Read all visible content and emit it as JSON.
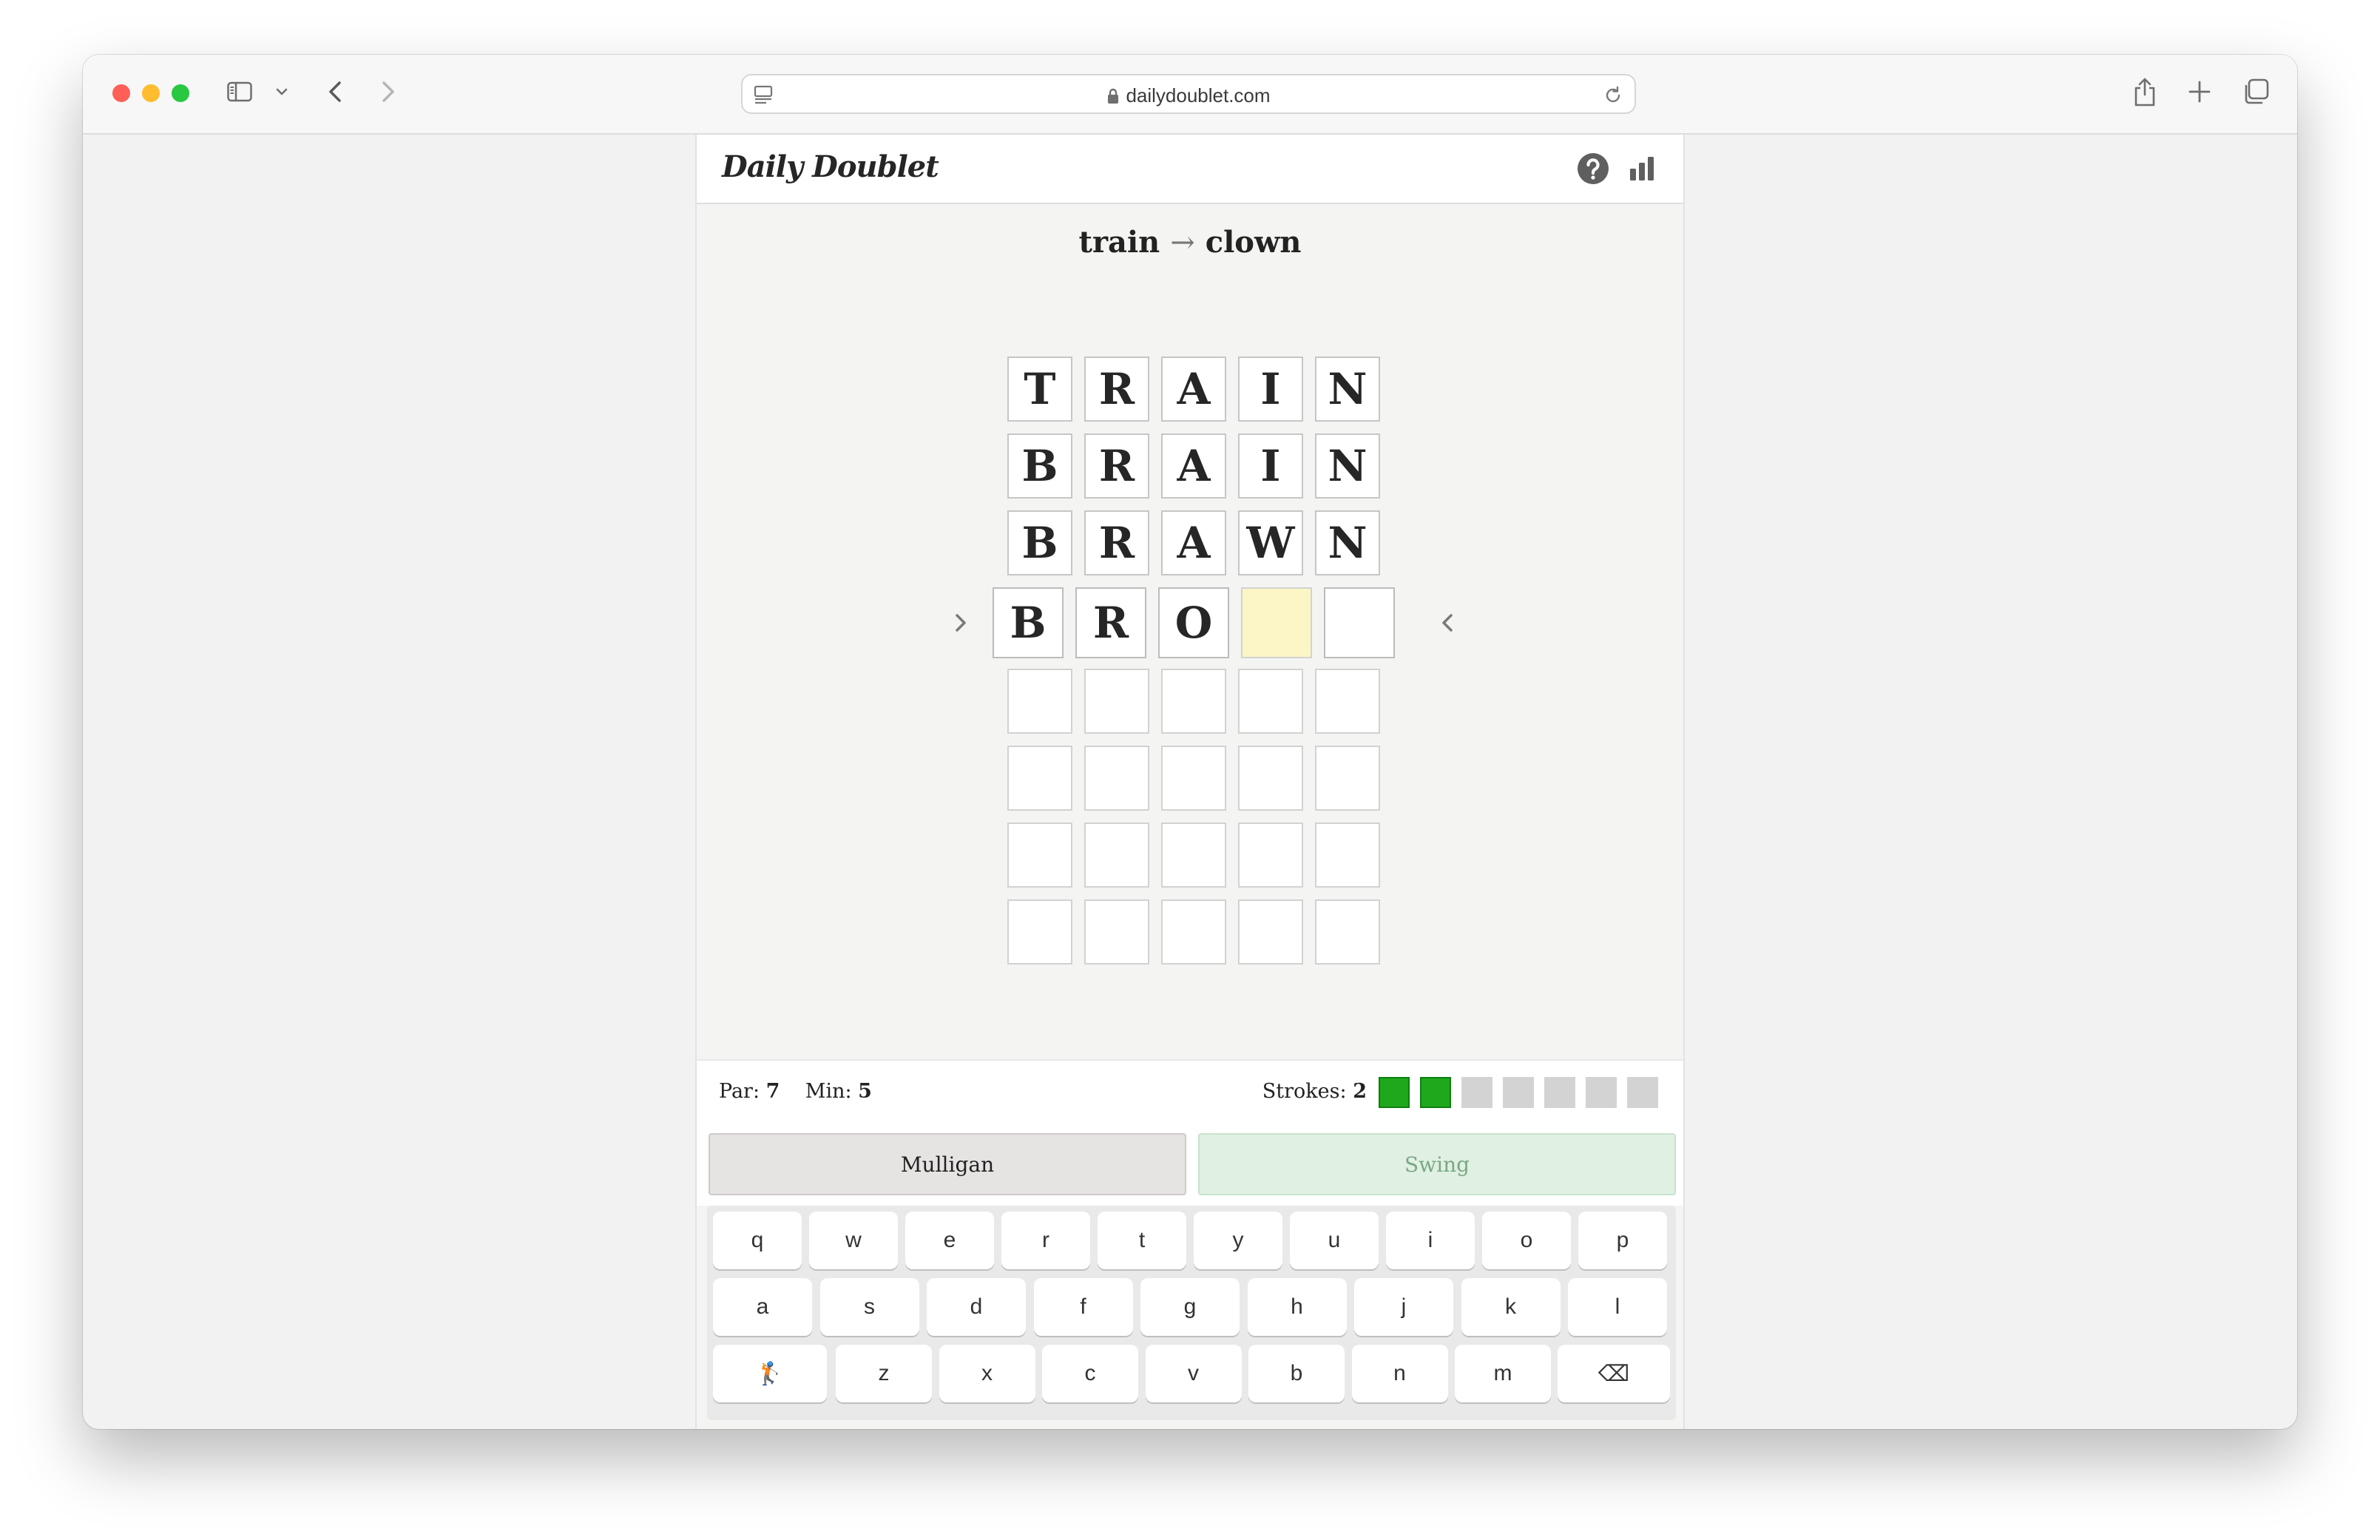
{
  "browser": {
    "url": "dailydoublet.com"
  },
  "app": {
    "title": "Daily Doublet",
    "icons": [
      "help-icon",
      "stats-icon"
    ]
  },
  "puzzle": {
    "start": "train",
    "arrow": "→",
    "end": "clown"
  },
  "board": {
    "rows": [
      [
        "T",
        "R",
        "A",
        "I",
        "N"
      ],
      [
        "B",
        "R",
        "A",
        "I",
        "N"
      ],
      [
        "B",
        "R",
        "A",
        "W",
        "N"
      ],
      [
        "B",
        "R",
        "O",
        "",
        ""
      ],
      [
        "",
        "",
        "",
        "",
        ""
      ],
      [
        "",
        "",
        "",
        "",
        ""
      ],
      [
        "",
        "",
        "",
        "",
        ""
      ],
      [
        "",
        "",
        "",
        "",
        ""
      ]
    ],
    "active_row": 3,
    "cursor_col": 3,
    "cursor_color": "#fcf6c6"
  },
  "status": {
    "par_label": "Par:",
    "par_value": "7",
    "min_label": "Min:",
    "min_value": "5",
    "strokes_label": "Strokes:",
    "strokes_value": "2",
    "stroke_slots": 7,
    "strokes_filled": 2,
    "stroke_color": "#1fa81c"
  },
  "actions": {
    "mulligan": "Mulligan",
    "swing": "Swing"
  },
  "keyboard": {
    "row1": [
      "q",
      "w",
      "e",
      "r",
      "t",
      "y",
      "u",
      "i",
      "o",
      "p"
    ],
    "row2": [
      "a",
      "s",
      "d",
      "f",
      "g",
      "h",
      "j",
      "k",
      "l"
    ],
    "row3": [
      "z",
      "x",
      "c",
      "v",
      "b",
      "n",
      "m"
    ],
    "golfer_key": "🏌",
    "backspace_key": "⌫"
  }
}
